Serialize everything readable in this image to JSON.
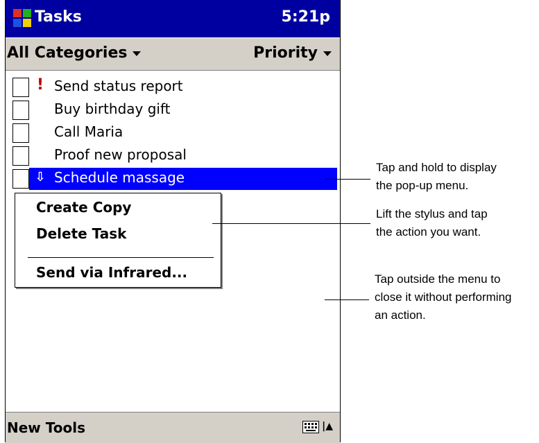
{
  "window": {
    "title": "Tasks",
    "clock": "5:21p"
  },
  "filters": {
    "categories": "All Categories",
    "sort": "Priority"
  },
  "tasks": [
    {
      "label": "Send status report",
      "priority": "high",
      "marker": "!"
    },
    {
      "label": "Buy birthday gift",
      "priority": "normal",
      "marker": ""
    },
    {
      "label": "Call Maria",
      "priority": "normal",
      "marker": ""
    },
    {
      "label": "Proof new proposal",
      "priority": "normal",
      "marker": ""
    },
    {
      "label": "Schedule massage",
      "priority": "low",
      "marker": "⇩",
      "selected": true
    }
  ],
  "popup_menu": {
    "items": [
      "Create Copy",
      "Delete Task",
      "Send via Infrared..."
    ]
  },
  "command_bar": {
    "menus": "New Tools"
  },
  "callouts": [
    {
      "lines": [
        "Tap and hold to display",
        "the pop-up menu."
      ]
    },
    {
      "lines": [
        "Lift the stylus and tap",
        "the action you want."
      ]
    },
    {
      "lines": [
        "Tap outside the menu to",
        "close it without performing",
        "an action."
      ]
    }
  ],
  "colors": {
    "title_bar": "#0000a0",
    "selection": "#0000ff",
    "chrome": "#d4d0c8",
    "priority_high": "#c00000"
  },
  "icons": {
    "app": "windows-flag-icon",
    "keyboard": "keyboard-icon",
    "sip": "up-arrow-icon"
  }
}
